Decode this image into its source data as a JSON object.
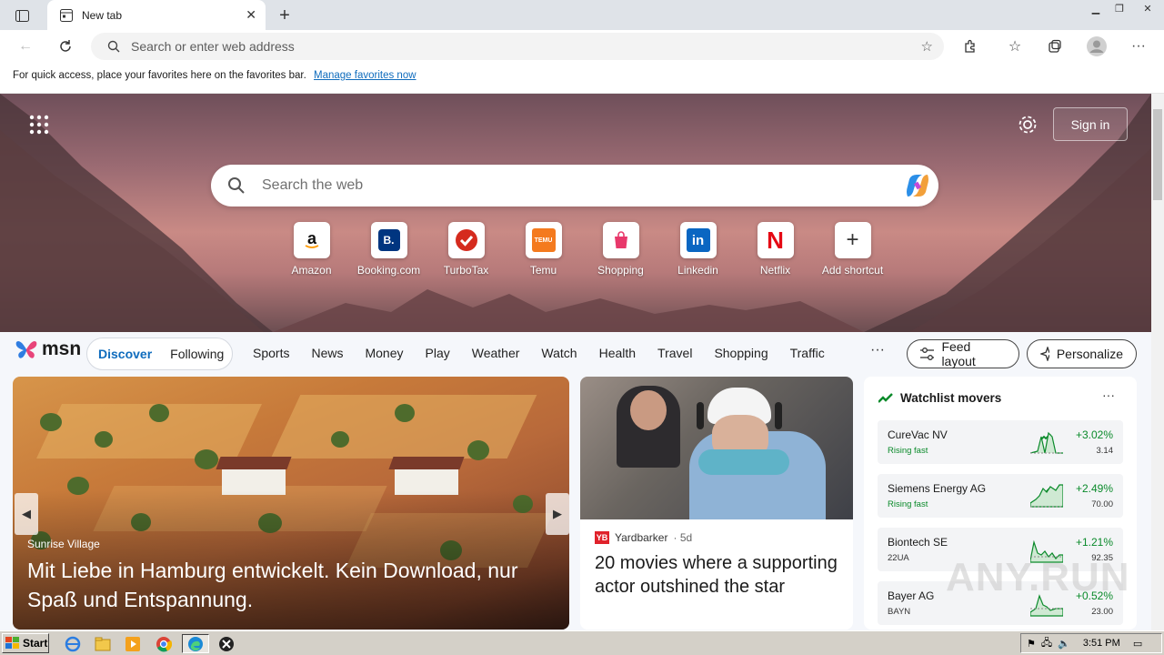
{
  "browser": {
    "tab_title": "New tab",
    "address_placeholder": "Search or enter web address"
  },
  "favorites_bar": {
    "message": "For quick access, place your favorites here on the favorites bar.",
    "link": "Manage favorites now"
  },
  "newtab": {
    "signin_label": "Sign in",
    "search_placeholder": "Search the web",
    "shortcuts": [
      {
        "label": "Amazon"
      },
      {
        "label": "Booking.com"
      },
      {
        "label": "TurboTax"
      },
      {
        "label": "Temu"
      },
      {
        "label": "Shopping"
      },
      {
        "label": "Linkedin"
      },
      {
        "label": "Netflix"
      },
      {
        "label": "Add shortcut"
      }
    ]
  },
  "msn": {
    "logo": "msn",
    "discover": "Discover",
    "following": "Following",
    "nav": [
      "Sports",
      "News",
      "Money",
      "Play",
      "Weather",
      "Watch",
      "Health",
      "Travel",
      "Shopping",
      "Traffic"
    ],
    "more": "···",
    "feed_layout": "Feed layout",
    "personalize": "Personalize"
  },
  "hero_card": {
    "source": "Sunrise Village",
    "headline": "Mit Liebe in Hamburg entwickelt. Kein Download, nur Spaß und Entspannung."
  },
  "card2": {
    "source": "Yardbarker",
    "age": "· 5d",
    "logo_text": "YB",
    "headline": "20 movies where a supporting actor outshined the star"
  },
  "watchlist": {
    "title": "Watchlist movers",
    "stocks": [
      {
        "name": "CureVac NV",
        "sub": "Rising fast",
        "change": "+3.02%",
        "price": "3.14"
      },
      {
        "name": "Siemens Energy AG",
        "sub": "Rising fast",
        "change": "+2.49%",
        "price": "70.00"
      },
      {
        "name": "Biontech SE",
        "sub": "22UA",
        "change": "+1.21%",
        "price": "92.35"
      },
      {
        "name": "Bayer AG",
        "sub": "BAYN",
        "change": "+0.52%",
        "price": "23.00"
      }
    ]
  },
  "watermark": "ANY.RUN",
  "taskbar": {
    "start": "Start",
    "clock": "3:51 PM"
  },
  "colors": {
    "accent": "#0f6cbd",
    "positive": "#0a8a2a"
  }
}
